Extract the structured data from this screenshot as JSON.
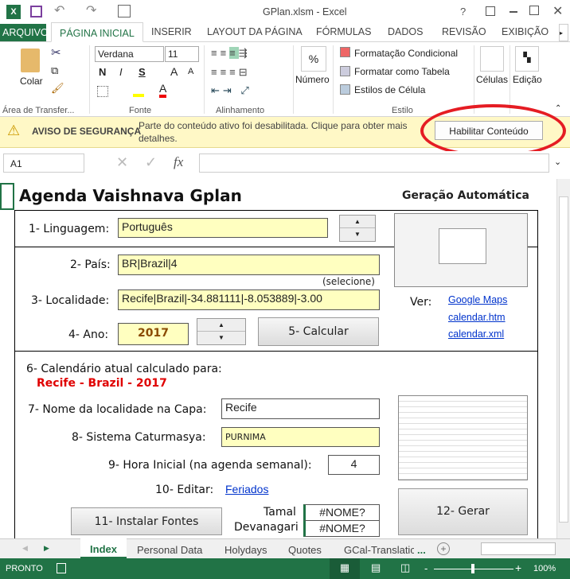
{
  "window": {
    "title": "GPlan.xlsm - Excel",
    "help": "?"
  },
  "ribbon_tabs": [
    "ARQUIVO",
    "PÁGINA INICIAL",
    "INSERIR",
    "LAYOUT DA PÁGINA",
    "FÓRMULAS",
    "DADOS",
    "REVISÃO",
    "EXIBIÇÃO"
  ],
  "ribbon": {
    "paste": "Colar",
    "font_name": "Verdana",
    "font_size": "11",
    "bold": "N",
    "italic": "I",
    "underline": "S",
    "number_icon": "%",
    "number": "Número",
    "cond_format": "Formatação Condicional",
    "format_table": "Formatar como Tabela",
    "cell_styles": "Estilos de Célula",
    "cells": "Células",
    "editing": "Edição",
    "groups": [
      "Área de Transfer...",
      "Fonte",
      "Alinhamento",
      "Estilo"
    ]
  },
  "security": {
    "title": "AVISO DE SEGURANÇA",
    "message": "Parte do conteúdo ativo foi desabilitada. Clique para obter mais detalhes.",
    "button": "Habilitar Conteúdo"
  },
  "formula_bar": {
    "name_box": "A1",
    "fx": "fx",
    "value": ""
  },
  "sheet": {
    "title": "Agenda Vaishnava Gplan",
    "subtitle": "Geração Automática",
    "lang_label": "1- Linguagem:",
    "lang_value": "Português",
    "country_label": "2- País:",
    "country_value": "BR|Brazil|4",
    "select_hint": "(selecione)",
    "locality_label": "3- Localidade:",
    "locality_value": "Recife|Brazil|-34.881111|-8.053889|-3.00",
    "year_label": "4- Ano:",
    "year_value": "2017",
    "calc_button": "5- Calcular",
    "see_label": "Ver:",
    "links": [
      "Google Maps",
      "calendar.htm",
      "calendar.xml"
    ],
    "calc_for_label": "6- Calendário atual calculado para:",
    "calc_for_value": "Recife - Brazil - 2017",
    "cover_label": "7- Nome da localidade na Capa:",
    "cover_value": "Recife",
    "system_label": "8- Sistema Caturmasya:",
    "system_value": "PURNIMA",
    "hour_label": "9- Hora Inicial (na agenda semanal):",
    "hour_value": "4",
    "edit_label": "10- Editar:",
    "edit_link": "Feriados",
    "fonts_button": "11- Instalar Fontes",
    "tamal_label": "Tamal",
    "tamal_value": "#NOME?",
    "deva_label": "Devanagari",
    "deva_value": "#NOME?",
    "generate_button": "12- Gerar"
  },
  "sheet_tabs": [
    "Index",
    "Personal Data",
    "Holydays",
    "Quotes",
    "GCal-Translatic"
  ],
  "sheet_tabs_more": "...",
  "status": {
    "ready": "PRONTO",
    "zoom": "100%"
  }
}
